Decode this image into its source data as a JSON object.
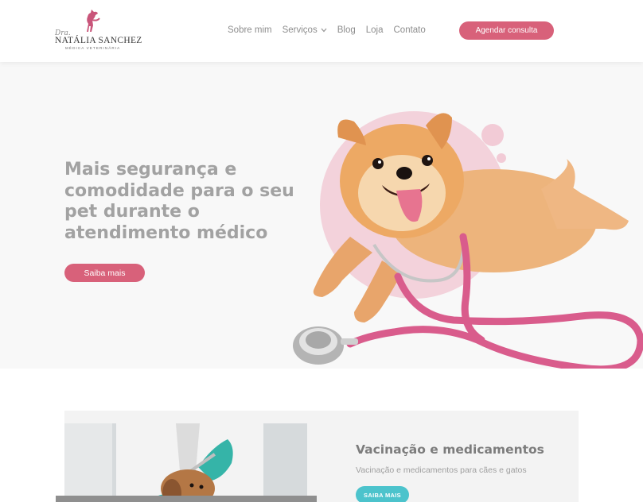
{
  "header": {
    "logo": {
      "prefix": "Dra.",
      "name": "NATÁLIA SANCHEZ",
      "subtitle": "MÉDICA VETERINÁRIA"
    },
    "nav": [
      {
        "label": "Sobre mim",
        "has_dropdown": false
      },
      {
        "label": "Serviços",
        "has_dropdown": true
      },
      {
        "label": "Blog",
        "has_dropdown": false
      },
      {
        "label": "Loja",
        "has_dropdown": false
      },
      {
        "label": "Contato",
        "has_dropdown": false
      }
    ],
    "cta_label": "Agendar consulta"
  },
  "hero": {
    "title": "Mais segurança e comodidade para o seu pet durante o atendimento médico",
    "button_label": "Saiba mais"
  },
  "service": {
    "title": "Vacinação e medicamentos",
    "description": "Vacinação e medicamentos para cães e gatos",
    "button_label": "SAIBA MAIS"
  },
  "colors": {
    "accent": "#d8617a",
    "teal": "#4cc3cc",
    "stethoscope": "#d95c8c",
    "blob": "#f2cbd6",
    "dog": "#e9a66a"
  }
}
